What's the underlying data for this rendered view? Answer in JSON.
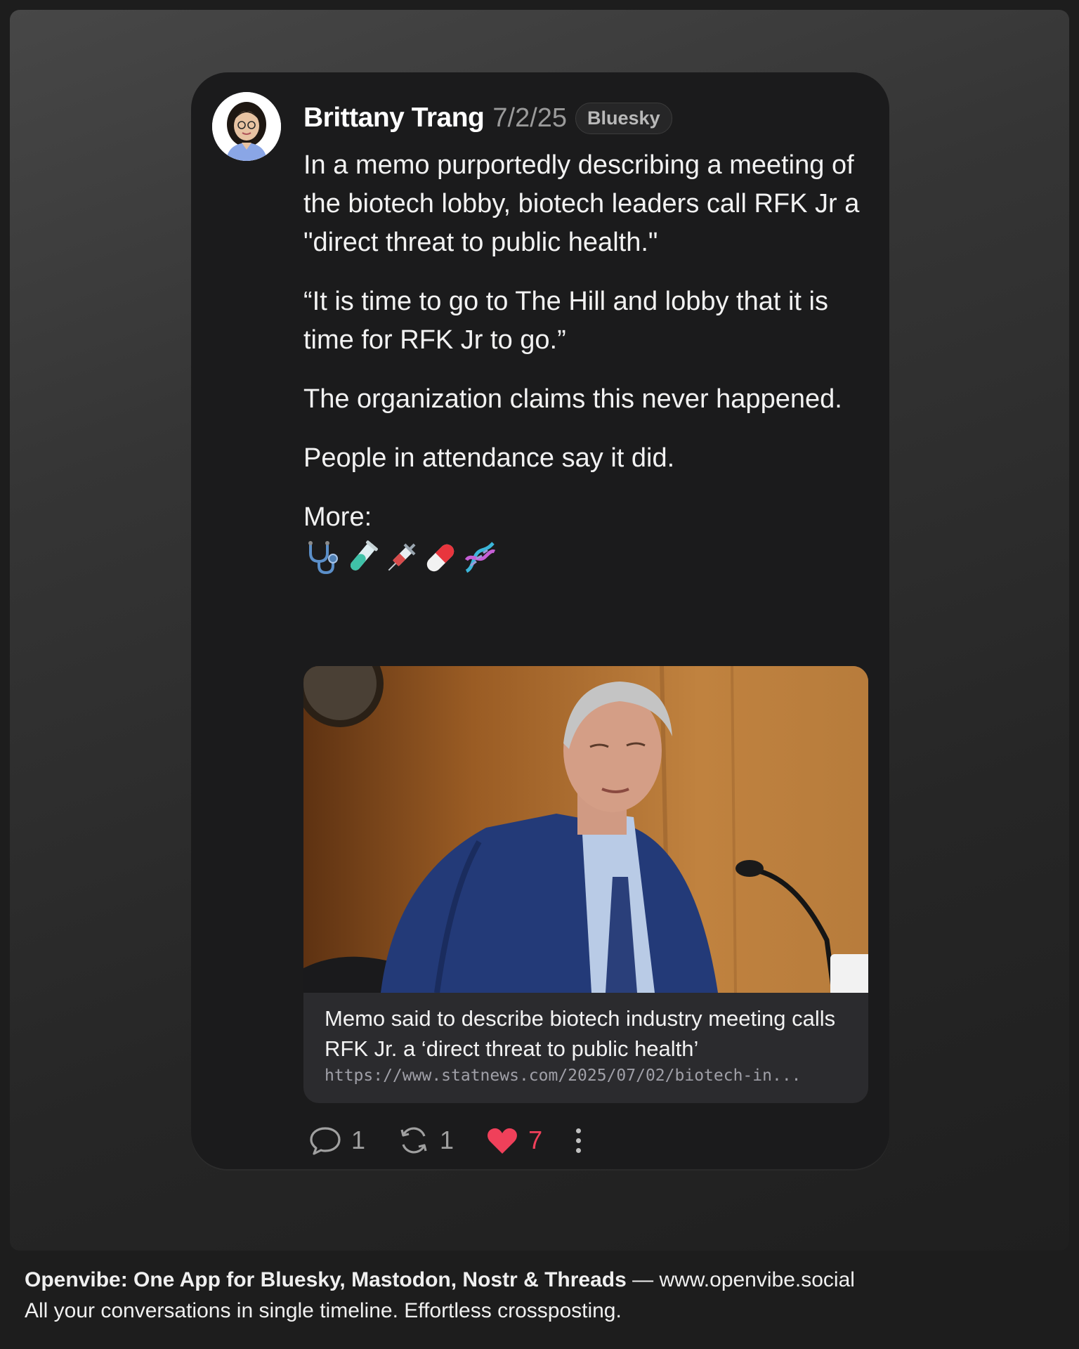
{
  "post": {
    "author": "Brittany Trang",
    "date": "7/2/25",
    "network_badge": "Bluesky",
    "paragraphs": [
      "In a memo purportedly describing a meeting of the biotech lobby, biotech leaders call RFK Jr a \"direct threat to public health.\"",
      "“It is time to go to The Hill and lobby that it is time for RFK Jr to go.”",
      "The organization claims this never happened.",
      "People in attendance say it did."
    ],
    "more_label": "More:",
    "emojis": [
      "stethoscope",
      "test-tube",
      "syringe",
      "pill",
      "dna"
    ],
    "link_card": {
      "title": "Memo said to describe biotech industry meeting calls RFK Jr. a ‘direct threat to public health’",
      "url": "https://www.statnews.com/2025/07/02/biotech-in..."
    },
    "actions": {
      "replies": "1",
      "reposts": "1",
      "likes": "7"
    }
  },
  "footer": {
    "brand_line": "Openvibe: One App for Bluesky, Mastodon, Nostr & Threads",
    "separator": " — ",
    "site": "www.openvibe.social",
    "tagline": "All your conversations in single timeline. Effortless crossposting."
  },
  "colors": {
    "like_accent": "#f0405a",
    "card_bg": "#1b1b1c"
  }
}
